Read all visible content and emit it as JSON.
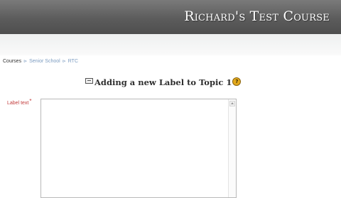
{
  "header": {
    "course_title": "Richard's Test Course"
  },
  "breadcrumb": {
    "items": [
      {
        "label": "Courses"
      },
      {
        "label": "Senior School"
      },
      {
        "label": "RTC"
      }
    ],
    "separator": "⊳"
  },
  "page": {
    "heading": "Adding a new Label to Topic 1",
    "help_glyph": "?"
  },
  "form": {
    "label_text": {
      "label": "Label text",
      "required_marker": "*",
      "value": ""
    }
  }
}
